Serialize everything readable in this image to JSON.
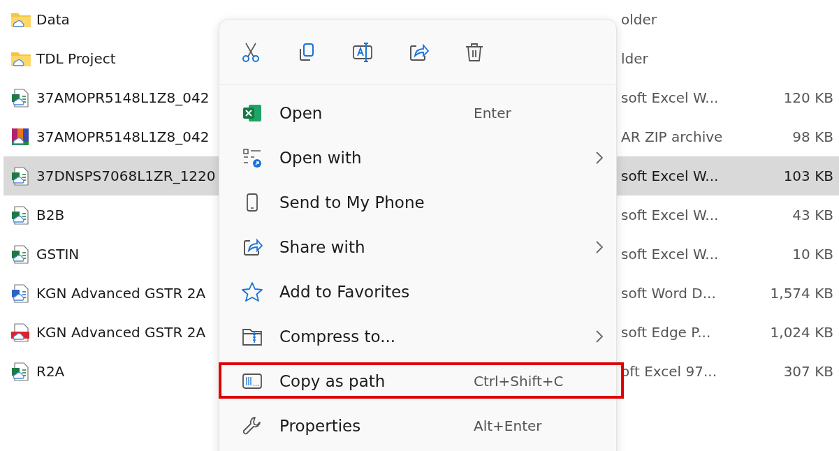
{
  "files": [
    {
      "name": "Data",
      "kind": "folder",
      "type": "older",
      "selected": false
    },
    {
      "name": "TDL Project",
      "kind": "folder",
      "type": "lder",
      "selected": false
    },
    {
      "name": "37AMOPR5148L1Z8_042",
      "kind": "excel",
      "type": "soft Excel W...",
      "size": "120 KB",
      "selected": false
    },
    {
      "name": "37AMOPR5148L1Z8_042",
      "kind": "archive",
      "type": "AR ZIP archive",
      "size": "98 KB",
      "selected": false
    },
    {
      "name": "37DNSPS7068L1ZR_1220",
      "kind": "excel",
      "type": "soft Excel W...",
      "size": "103 KB",
      "selected": true
    },
    {
      "name": "B2B",
      "kind": "excel",
      "type": "soft Excel W...",
      "size": "43 KB",
      "selected": false
    },
    {
      "name": "GSTIN",
      "kind": "excel",
      "type": "soft Excel W...",
      "size": "10 KB",
      "selected": false
    },
    {
      "name": "KGN Advanced GSTR 2A",
      "kind": "word",
      "type": "soft Word D...",
      "size": "1,574 KB",
      "selected": false
    },
    {
      "name": "KGN Advanced GSTR 2A",
      "kind": "pdf",
      "type": "soft Edge P...",
      "size": "1,024 KB",
      "selected": false
    },
    {
      "name": "R2A",
      "kind": "excel",
      "type": "oft Excel 97...",
      "size": "307 KB",
      "selected": false
    }
  ],
  "context_menu": {
    "toolbar": [
      {
        "kind": "cut"
      },
      {
        "kind": "copy"
      },
      {
        "kind": "rename"
      },
      {
        "kind": "share"
      },
      {
        "kind": "delete"
      }
    ],
    "items": [
      {
        "kind": "excel",
        "label": "Open",
        "shortcut": "Enter",
        "submenu": false,
        "highlighted": false
      },
      {
        "kind": "open-with",
        "label": "Open with",
        "submenu": true,
        "highlighted": false
      },
      {
        "kind": "phone",
        "label": "Send to My Phone",
        "submenu": false,
        "highlighted": false
      },
      {
        "kind": "share",
        "label": "Share with",
        "submenu": true,
        "highlighted": false
      },
      {
        "kind": "star",
        "label": "Add to Favorites",
        "submenu": false,
        "highlighted": false
      },
      {
        "kind": "zip",
        "label": "Compress to...",
        "submenu": true,
        "highlighted": false
      },
      {
        "kind": "path",
        "label": "Copy as path",
        "shortcut": "Ctrl+Shift+C",
        "submenu": false,
        "highlighted": true
      },
      {
        "kind": "wrench",
        "label": "Properties",
        "shortcut": "Alt+Enter",
        "submenu": false,
        "highlighted": false
      }
    ]
  }
}
